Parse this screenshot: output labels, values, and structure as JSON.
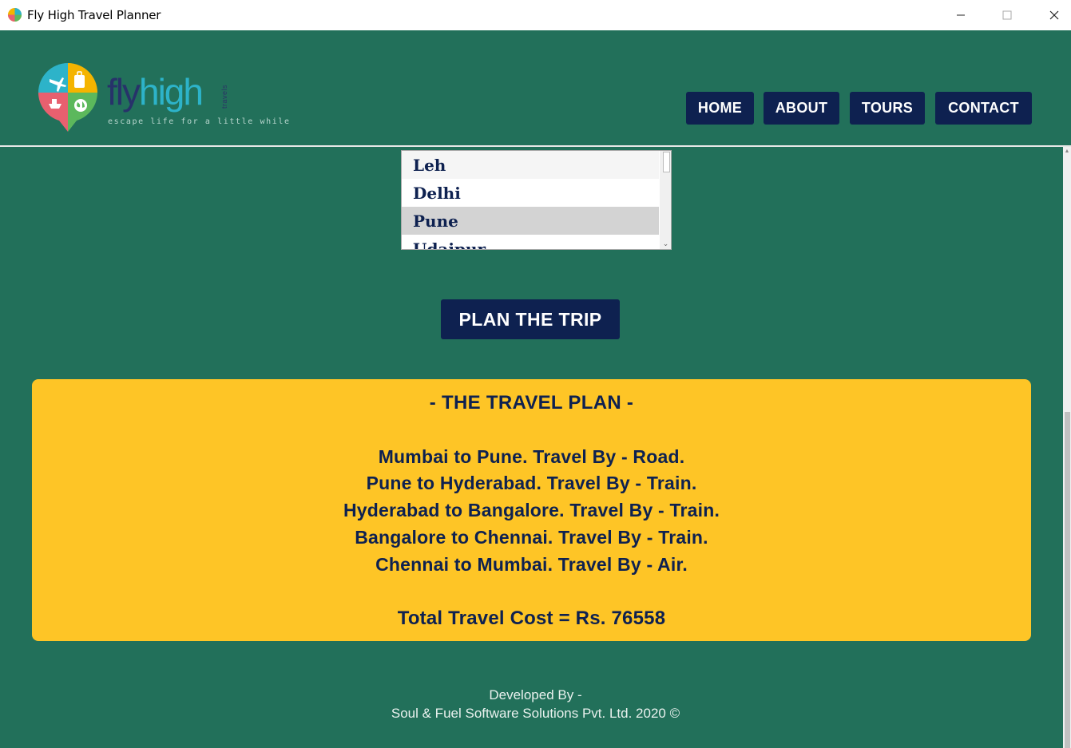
{
  "window": {
    "title": "Fly High Travel Planner",
    "minimize_glyph": "—",
    "maximize_glyph": "☐",
    "close_glyph": "✕"
  },
  "logo": {
    "word_fly": "fly",
    "word_high": "high",
    "vertical": "travels",
    "tagline": "escape life for a little while",
    "icon": "map-pin-logo-icon"
  },
  "nav": {
    "home": "HOME",
    "about": "ABOUT",
    "tours": "TOURS",
    "contact": "CONTACT"
  },
  "destinations": {
    "items": [
      "Leh",
      "Delhi",
      "Pune",
      "Udaipur"
    ],
    "selected": "Pune"
  },
  "plan_button": "PLAN THE TRIP",
  "plan": {
    "title": "- THE TRAVEL PLAN -",
    "lines": [
      "Mumbai to Pune. Travel By - Road.",
      "Pune to Hyderabad. Travel By - Train.",
      "Hyderabad to Bangalore. Travel By - Train.",
      "Bangalore to Chennai. Travel By - Train.",
      "Chennai to Mumbai. Travel By - Air."
    ],
    "total": "Total Travel Cost = Rs. 76558"
  },
  "footer": {
    "line1": "Developed By -",
    "line2": "Soul & Fuel Software Solutions Pvt. Ltd. 2020 ©"
  },
  "colors": {
    "background": "#22705a",
    "navy": "#0e2150",
    "card": "#fec526"
  }
}
